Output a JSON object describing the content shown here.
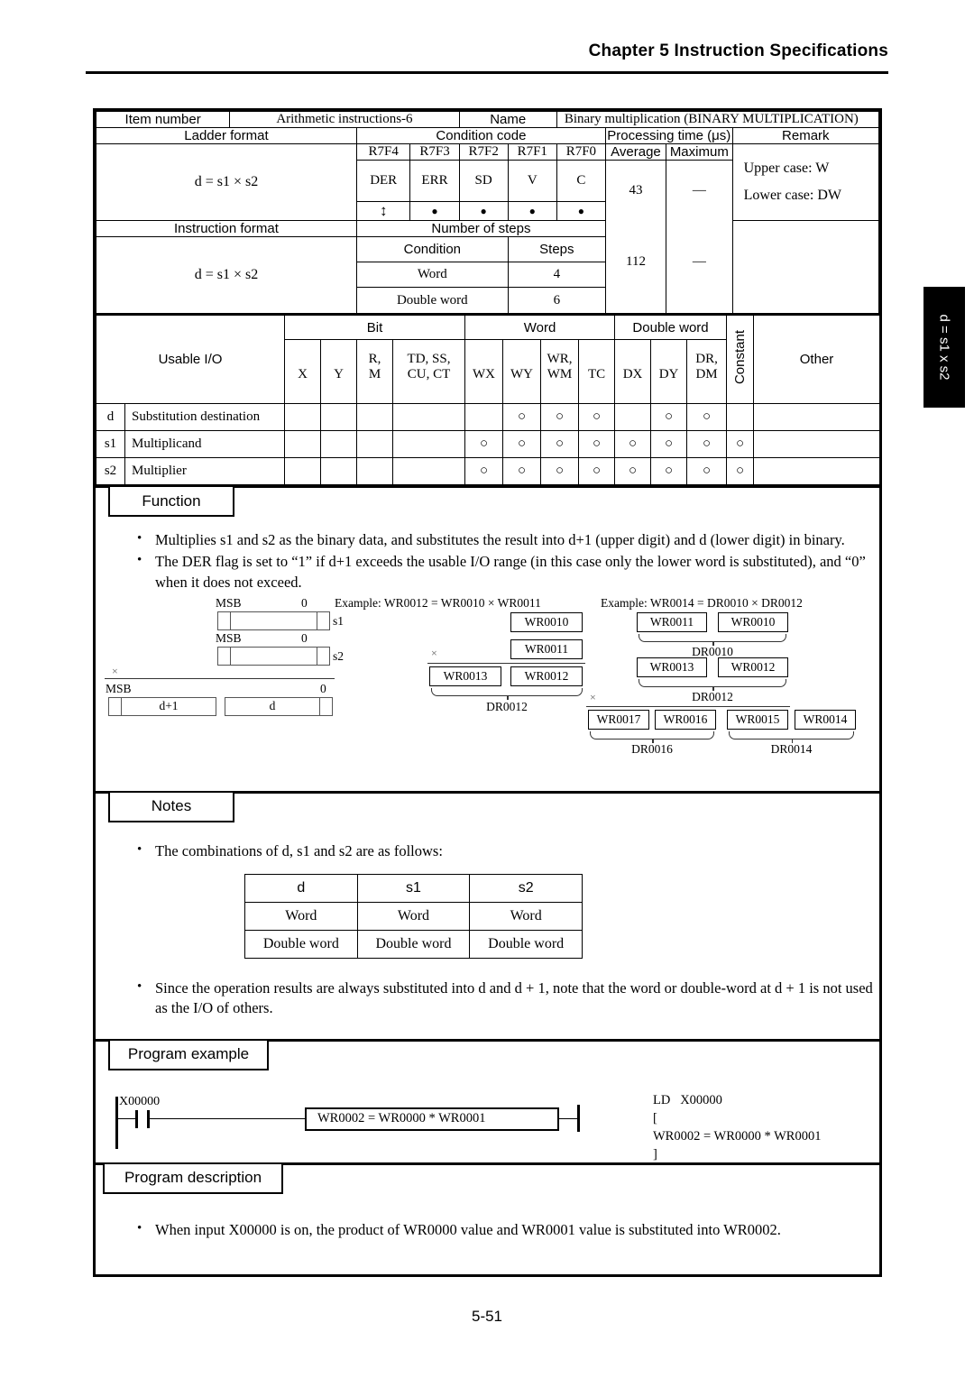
{
  "header": {
    "chapter": "Chapter 5  Instruction Specifications"
  },
  "footer": {
    "page": "5-51"
  },
  "side_tab": {
    "label": "d = s1 x s2"
  },
  "spec": {
    "item_number_label": "Item number",
    "item_number_value": "Arithmetic instructions-6",
    "name_label": "Name",
    "name_value": "Binary multiplication (BINARY MULTIPLICATION)",
    "ladder_format_label": "Ladder format",
    "condition_code_label": "Condition code",
    "processing_time_label": "Processing time (μs)",
    "remark_label": "Remark",
    "flag_addresses": [
      "R7F4",
      "R7F3",
      "R7F2",
      "R7F1",
      "R7F0"
    ],
    "flag_names": [
      "DER",
      "ERR",
      "SD",
      "V",
      "C"
    ],
    "flag_marks": [
      "↕",
      "●",
      "●",
      "●",
      "●"
    ],
    "average_label": "Average",
    "maximum_label": "Maximum",
    "ladder_expression": "d = s1 × s2",
    "average_value_1": "43",
    "maximum_value_1": "—",
    "remark_line1": "Upper case: W",
    "remark_line2": "Lower case: DW",
    "instruction_format_label": "Instruction format",
    "number_of_steps_label": "Number of steps",
    "condition_label": "Condition",
    "steps_label": "Steps",
    "instruction_expression": "d = s1 × s2",
    "steps_rows": [
      {
        "condition": "Word",
        "steps": "4"
      },
      {
        "condition": "Double word",
        "steps": "6"
      }
    ],
    "average_value_2": "112",
    "maximum_value_2": "—"
  },
  "usable_io": {
    "title": "Usable I/O",
    "group_bit": "Bit",
    "group_word": "Word",
    "group_double_word": "Double word",
    "constant": "Constant",
    "other": "Other",
    "columns": [
      {
        "top": "",
        "bottom": "X"
      },
      {
        "top": "",
        "bottom": "Y"
      },
      {
        "top": "R,",
        "bottom": "M"
      },
      {
        "top": "TD, SS,",
        "bottom": "CU, CT"
      },
      {
        "top": "",
        "bottom": "WX"
      },
      {
        "top": "",
        "bottom": "WY"
      },
      {
        "top": "WR,",
        "bottom": "WM"
      },
      {
        "top": "",
        "bottom": "TC"
      },
      {
        "top": "",
        "bottom": "DX"
      },
      {
        "top": "",
        "bottom": "DY"
      },
      {
        "top": "DR,",
        "bottom": "DM"
      }
    ],
    "mark": "○",
    "rows": [
      {
        "code": "d",
        "desc": "Substitution destination",
        "cells": [
          "",
          "",
          "",
          "",
          "",
          "○",
          "○",
          "○",
          "",
          "○",
          "○"
        ],
        "constant": "",
        "other": ""
      },
      {
        "code": "s1",
        "desc": "Multiplicand",
        "cells": [
          "",
          "",
          "",
          "",
          "○",
          "○",
          "○",
          "○",
          "○",
          "○",
          "○"
        ],
        "constant": "○",
        "other": ""
      },
      {
        "code": "s2",
        "desc": "Multiplier",
        "cells": [
          "",
          "",
          "",
          "",
          "○",
          "○",
          "○",
          "○",
          "○",
          "○",
          "○"
        ],
        "constant": "○",
        "other": ""
      }
    ]
  },
  "function": {
    "tab": "Function",
    "bullets": [
      "Multiplies s1 and s2 as the binary data, and substitutes the result into d+1 (upper digit) and d (lower digit) in binary.",
      "The DER flag is set to “1” if d+1 exceeds the usable I/O range (in this case only the lower word is substituted), and “0” when it does not exceed."
    ],
    "diagram_left": {
      "msb": "MSB",
      "zero": "0",
      "s1": "s1",
      "s2": "s2",
      "times": "×",
      "dplus1": "d+1",
      "d": "d"
    },
    "diagram_mid": {
      "caption": "Example: WR0012 = WR0010 × WR0011",
      "operand1": "WR0010",
      "operand2": "WR0011",
      "times": "×",
      "result_hi": "WR0013",
      "result_lo": "WR0012",
      "result_label": "DR0012"
    },
    "diagram_right": {
      "caption": "Example: WR0014 = DR0010 × DR0012",
      "op1_hi": "WR0011",
      "op1_lo": "WR0010",
      "op1_label": "DR0010",
      "op2_hi": "WR0013",
      "op2_lo": "WR0012",
      "op2_label": "DR0012",
      "times": "×",
      "res_a_hi": "WR0017",
      "res_a_lo": "WR0016",
      "res_a_label": "DR0016",
      "res_b_hi": "WR0015",
      "res_b_lo": "WR0014",
      "res_b_label": "DR0014"
    }
  },
  "notes": {
    "tab": "Notes",
    "bullet1": "The combinations of d, s1 and s2 are as follows:",
    "combo_headers": [
      "d",
      "s1",
      "s2"
    ],
    "combo_rows": [
      [
        "Word",
        "Word",
        "Word"
      ],
      [
        "Double word",
        "Double word",
        "Double word"
      ]
    ],
    "bullet2": "Since the operation results are always substituted into d and d + 1, note that the word or double-word at d + 1 is not used as the I/O of others."
  },
  "program_example": {
    "tab": "Program example",
    "input_label": "X00000",
    "instruction_box": "WR0002 = WR0000 * WR0001",
    "mnemonic_line1": "LD   X00000",
    "mnemonic_line2": "[",
    "mnemonic_line3": "WR0002 = WR0000 * WR0001",
    "mnemonic_line4": "]"
  },
  "program_description": {
    "tab": "Program description",
    "bullet": "When input X00000 is on, the product of WR0000 value and WR0001 value is substituted into WR0002."
  }
}
